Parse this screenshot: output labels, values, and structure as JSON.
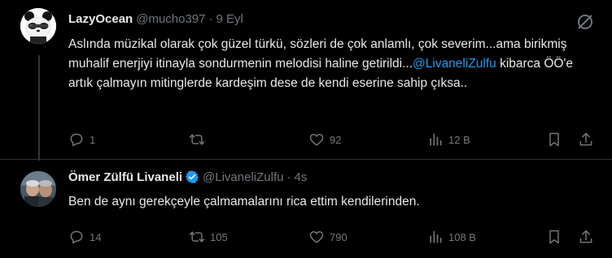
{
  "tweets": [
    {
      "name": "LazyOcean",
      "handle": "@mucho397",
      "separator": "·",
      "time": "9 Eyl",
      "text_before": "Aslında müzikal olarak çok güzel türkü, sözleri de çok anlamlı, çok severim...ama birikmiş muhalif enerjiyi itinayla sondurmenin melodisi haline getirildi...",
      "mention": "@LivaneliZulfu",
      "text_after": " kibarca ÖÖ'e artık çalmayın mitinglerde kardeşim dese de kendi eserine sahip çıksa..",
      "replies": "1",
      "retweets": "",
      "likes": "92",
      "views": "12 B"
    },
    {
      "name": "Ömer Zülfü Livaneli",
      "handle": "@LivaneliZulfu",
      "separator": "·",
      "time": "4s",
      "text": "Ben de aynı gerekçeyle çalmamalarını rica ettim kendilerinden.",
      "replies": "14",
      "retweets": "105",
      "likes": "790",
      "views": "108 B"
    }
  ],
  "colors": {
    "background": "#000000",
    "text": "#e7e9ea",
    "muted": "#71767b",
    "link": "#1d9bf0",
    "verified": "#1d9bf0"
  },
  "icons": [
    "reply-icon",
    "retweet-icon",
    "like-icon",
    "views-icon",
    "bookmark-icon",
    "share-icon",
    "grok-icon",
    "verified-badge-icon"
  ]
}
